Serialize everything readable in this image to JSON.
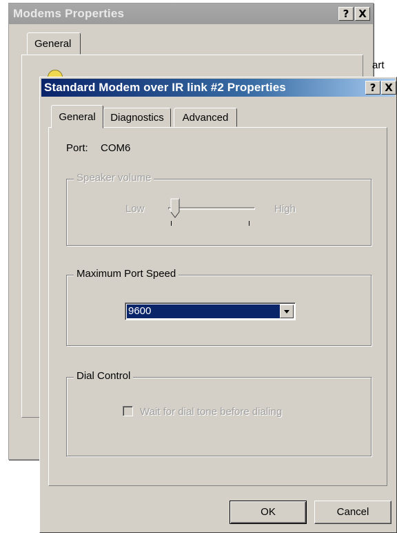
{
  "background_window": {
    "title": "Modems Properties",
    "help_label": "?",
    "close_label": "X",
    "tab_general": "General",
    "cut_text": "art"
  },
  "dialog": {
    "title": "Standard Modem over IR link #2 Properties",
    "help_label": "?",
    "close_label": "X",
    "tabs": [
      {
        "label": "General",
        "active": true
      },
      {
        "label": "Diagnostics",
        "active": false
      },
      {
        "label": "Advanced",
        "active": false
      }
    ],
    "port_label": "Port:",
    "port_value": "COM6",
    "speaker_volume": {
      "label": "Speaker volume",
      "low": "Low",
      "high": "High",
      "level": 0.1,
      "enabled": false
    },
    "max_port_speed": {
      "label": "Maximum Port Speed",
      "selected": "9600"
    },
    "dial_control": {
      "label": "Dial Control",
      "wait_for_dial_tone": "Wait for dial tone before dialing",
      "checked": false,
      "enabled": false
    },
    "ok_label": "OK",
    "cancel_label": "Cancel"
  },
  "colors": {
    "face": "#d4d0c8",
    "title_active": "#0a246a",
    "title_inactive": "#9c9c9c",
    "selection": "#0a246a"
  }
}
